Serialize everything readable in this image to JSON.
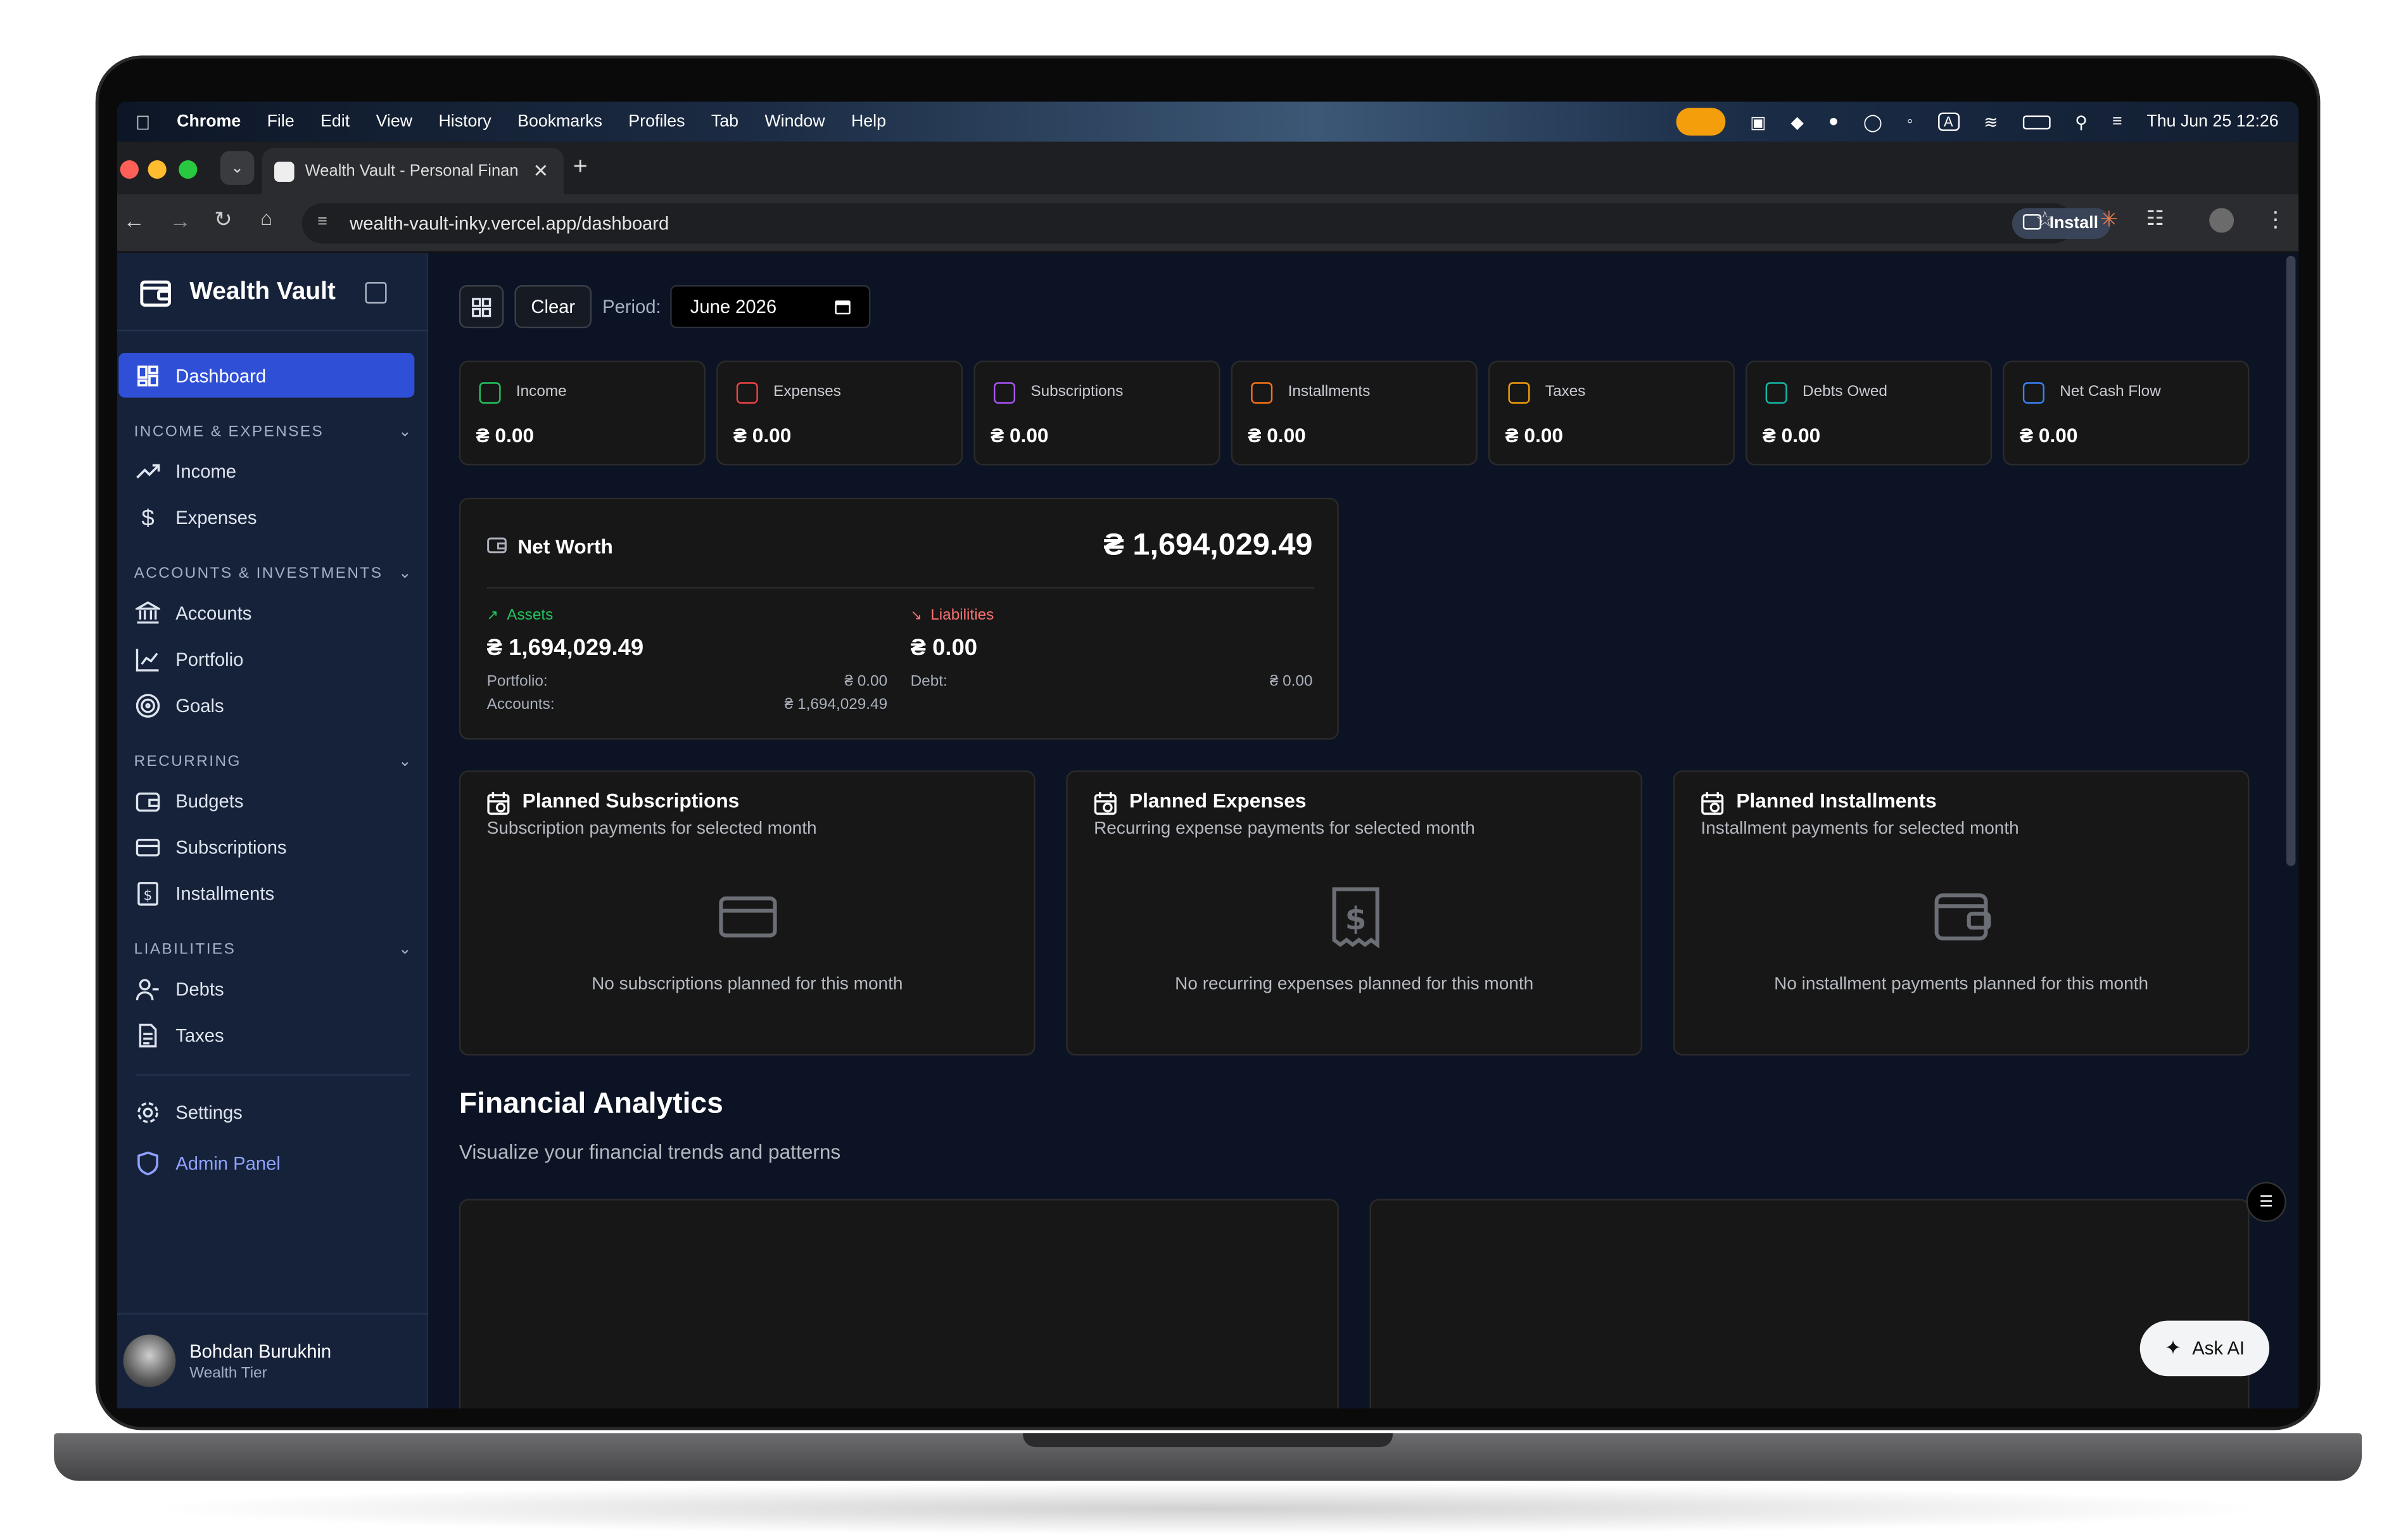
{
  "menubar": {
    "app": "Chrome",
    "items": [
      "File",
      "Edit",
      "View",
      "History",
      "Bookmarks",
      "Profiles",
      "Tab",
      "Window",
      "Help"
    ],
    "datetime": "Thu Jun 25  12:26"
  },
  "browser": {
    "tab_title": "Wealth Vault - Personal Finan",
    "url": "wealth-vault-inky.vercel.app/dashboard",
    "install_label": "Install"
  },
  "sidebar": {
    "brand": "Wealth Vault",
    "dashboard": "Dashboard",
    "groups": {
      "income_expenses": "INCOME & EXPENSES",
      "accounts_investments": "ACCOUNTS & INVESTMENTS",
      "recurring": "RECURRING",
      "liabilities": "LIABILITIES"
    },
    "items": {
      "income": "Income",
      "expenses": "Expenses",
      "accounts": "Accounts",
      "portfolio": "Portfolio",
      "goals": "Goals",
      "budgets": "Budgets",
      "subscriptions": "Subscriptions",
      "installments": "Installments",
      "debts": "Debts",
      "taxes": "Taxes",
      "settings": "Settings",
      "admin": "Admin Panel"
    },
    "user": {
      "name": "Bohdan Burukhin",
      "tier": "Wealth Tier"
    }
  },
  "toolbar": {
    "clear": "Clear",
    "period_label": "Period:",
    "period_value": "June 2026"
  },
  "stats": [
    {
      "label": "Income",
      "value": "₴ 0.00",
      "color": "#22c55e"
    },
    {
      "label": "Expenses",
      "value": "₴ 0.00",
      "color": "#ef4444"
    },
    {
      "label": "Subscriptions",
      "value": "₴ 0.00",
      "color": "#a855f7"
    },
    {
      "label": "Installments",
      "value": "₴ 0.00",
      "color": "#f97316"
    },
    {
      "label": "Taxes",
      "value": "₴ 0.00",
      "color": "#f59e0b"
    },
    {
      "label": "Debts Owed",
      "value": "₴ 0.00",
      "color": "#14b8a6"
    },
    {
      "label": "Net Cash Flow",
      "value": "₴ 0.00",
      "color": "#3b82f6"
    }
  ],
  "networth": {
    "title": "Net Worth",
    "total": "₴ 1,694,029.49",
    "assets_label": "Assets",
    "assets_value": "₴ 1,694,029.49",
    "liabilities_label": "Liabilities",
    "liabilities_value": "₴ 0.00",
    "portfolio_label": "Portfolio:",
    "portfolio_value": "₴ 0.00",
    "accounts_label": "Accounts:",
    "accounts_value": "₴ 1,694,029.49",
    "debt_label": "Debt:",
    "debt_value": "₴ 0.00"
  },
  "planned": [
    {
      "title": "Planned Subscriptions",
      "subtitle": "Subscription payments for selected month",
      "empty": "No subscriptions planned for this month"
    },
    {
      "title": "Planned Expenses",
      "subtitle": "Recurring expense payments for selected month",
      "empty": "No recurring expenses planned for this month"
    },
    {
      "title": "Planned Installments",
      "subtitle": "Installment payments for selected month",
      "empty": "No installment payments planned for this month"
    }
  ],
  "analytics": {
    "title": "Financial Analytics",
    "subtitle": "Visualize your financial trends and patterns"
  },
  "ask_ai": "Ask AI",
  "colors": {
    "accent": "#2f4fd6",
    "admin": "#8ea2ff",
    "assets": "#22c55e",
    "liabilities": "#f87171"
  }
}
